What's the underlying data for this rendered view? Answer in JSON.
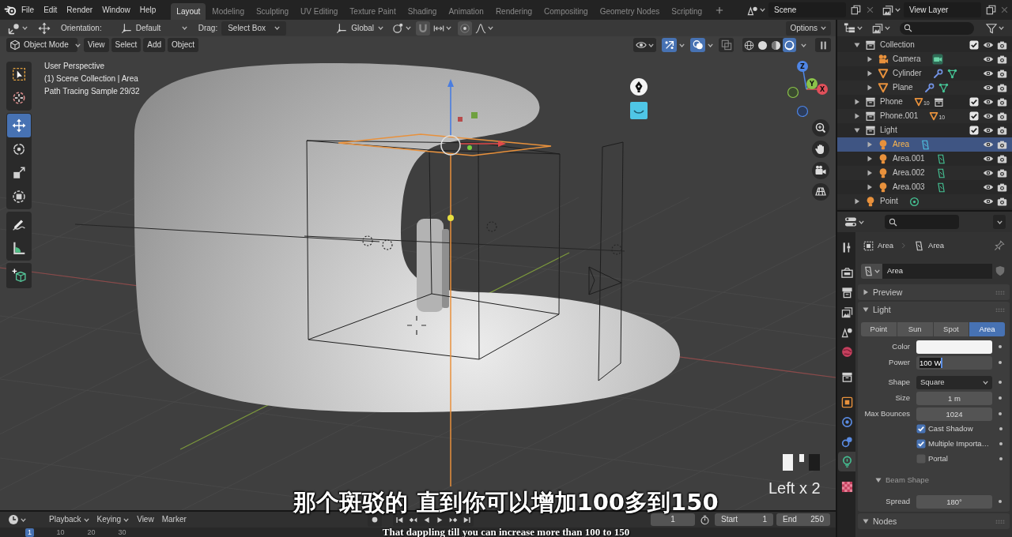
{
  "topbar": {
    "menus": [
      "File",
      "Edit",
      "Render",
      "Window",
      "Help"
    ],
    "workspaces": [
      {
        "label": "Layout",
        "selected": true
      },
      {
        "label": "Modeling",
        "selected": false
      },
      {
        "label": "Sculpting",
        "selected": false
      },
      {
        "label": "UV Editing",
        "selected": false
      },
      {
        "label": "Texture Paint",
        "selected": false
      },
      {
        "label": "Shading",
        "selected": false
      },
      {
        "label": "Animation",
        "selected": false
      },
      {
        "label": "Rendering",
        "selected": false
      },
      {
        "label": "Compositing",
        "selected": false
      },
      {
        "label": "Geometry Nodes",
        "selected": false
      },
      {
        "label": "Scripting",
        "selected": false
      }
    ],
    "scene": "Scene",
    "view_layer": "View Layer"
  },
  "viewport": {
    "tool_settings": {
      "orientation_label": "Orientation:",
      "orientation": "Default",
      "drag_label": "Drag:",
      "drag": "Select Box",
      "transform_orientation": "Global",
      "options": "Options"
    },
    "header": {
      "mode": "Object Mode",
      "menus": [
        "View",
        "Select",
        "Add",
        "Object"
      ],
      "toggles": [
        {
          "kind": "gizmos",
          "on": true
        },
        {
          "kind": "overlays",
          "on": true
        },
        {
          "kind": "xray",
          "on": false
        }
      ],
      "shading": [
        {
          "kind": "wireframe",
          "selected": false
        },
        {
          "kind": "solid",
          "selected": false
        },
        {
          "kind": "material",
          "selected": false
        },
        {
          "kind": "rendered",
          "selected": true
        }
      ]
    },
    "tools": [
      {
        "kind": "select_box",
        "selected": false
      },
      {
        "kind": "cursor",
        "selected": false
      },
      {
        "kind": "move",
        "selected": true
      },
      {
        "kind": "rotate",
        "selected": false
      },
      {
        "kind": "scale",
        "selected": false
      },
      {
        "kind": "transform",
        "selected": false
      },
      {
        "kind": "annotate",
        "selected": false
      },
      {
        "kind": "measure",
        "selected": false
      },
      {
        "kind": "add_cube",
        "selected": false
      }
    ],
    "info": [
      "User Perspective",
      "(1) Scene Collection | Area",
      "Path Tracing Sample 29/32"
    ],
    "gizmo_axes": [
      "X",
      "Y",
      "Z"
    ],
    "keystroke": "Left x 2",
    "subtitles": [
      "那个斑驳的 直到你可以增加100多到150",
      "That dappling till you can increase more than 100 to 150"
    ]
  },
  "timeline": {
    "menus": [
      {
        "label": "Playback",
        "kind": "popover"
      },
      {
        "label": "Keying",
        "kind": "popover"
      },
      {
        "label": "View",
        "kind": "menu"
      },
      {
        "label": "Marker",
        "kind": "menu"
      }
    ],
    "frame": "1",
    "start_label": "Start",
    "start": "1",
    "end_label": "End",
    "end": "250",
    "ruler": [
      {
        "label": "1",
        "selected": true
      },
      {
        "label": "10",
        "selected": false
      },
      {
        "label": "20",
        "selected": false
      },
      {
        "label": "30",
        "selected": false
      }
    ]
  },
  "outliner": {
    "items": [
      {
        "kind": "collection",
        "name": "Collection",
        "expanded": true,
        "checked": true,
        "selected": false,
        "children": [
          {
            "kind": "camera",
            "name": "Camera",
            "expanded": false,
            "selected": false,
            "data": [
              {
                "kind": "camera_data"
              }
            ]
          },
          {
            "kind": "mesh",
            "name": "Cylinder",
            "expanded": false,
            "selected": false,
            "data": [
              {
                "kind": "modifier"
              },
              {
                "kind": "mesh_data"
              }
            ]
          },
          {
            "kind": "mesh",
            "name": "Plane",
            "expanded": false,
            "selected": false,
            "data": [
              {
                "kind": "modifier"
              },
              {
                "kind": "mesh_data"
              }
            ]
          }
        ]
      },
      {
        "kind": "collection",
        "name": "Phone",
        "expanded": false,
        "checked": true,
        "selected": false,
        "data": [
          {
            "kind": "mesh_objects",
            "count": "10"
          },
          {
            "kind": "collection"
          }
        ]
      },
      {
        "kind": "collection",
        "name": "Phone.001",
        "expanded": false,
        "checked": true,
        "selected": false,
        "data": [
          {
            "kind": "mesh_objects",
            "count": "10"
          }
        ]
      },
      {
        "kind": "collection",
        "name": "Light",
        "expanded": true,
        "checked": true,
        "selected": false,
        "children": [
          {
            "kind": "light",
            "name": "Area",
            "expanded": false,
            "selected": true,
            "data": [
              {
                "kind": "area_light_data"
              }
            ]
          },
          {
            "kind": "light",
            "name": "Area.001",
            "expanded": false,
            "selected": false,
            "data": [
              {
                "kind": "area_light_data"
              }
            ]
          },
          {
            "kind": "light",
            "name": "Area.002",
            "expanded": false,
            "selected": false,
            "data": [
              {
                "kind": "area_light_data"
              }
            ]
          },
          {
            "kind": "light",
            "name": "Area.003",
            "expanded": false,
            "selected": false,
            "data": [
              {
                "kind": "area_light_data"
              }
            ]
          }
        ]
      },
      {
        "kind": "light",
        "name": "Point",
        "expanded": false,
        "selected": false,
        "data": [
          {
            "kind": "point_light_data"
          }
        ]
      }
    ]
  },
  "properties": {
    "tabs": [
      {
        "kind": "tool",
        "selected": false
      },
      {
        "kind": "render",
        "selected": false
      },
      {
        "kind": "output",
        "selected": false
      },
      {
        "kind": "view_layer",
        "selected": false
      },
      {
        "kind": "scene",
        "selected": false
      },
      {
        "kind": "world",
        "selected": false
      },
      {
        "kind": "collection",
        "selected": false
      },
      {
        "kind": "object",
        "selected": false
      },
      {
        "kind": "physics",
        "selected": false
      },
      {
        "kind": "constraints",
        "selected": false
      },
      {
        "kind": "data",
        "selected": true
      },
      {
        "kind": "texture",
        "selected": false
      }
    ],
    "breadcrumb": [
      {
        "kind": "object",
        "label": "Area"
      },
      {
        "kind": "light_data",
        "label": "Area"
      }
    ],
    "datablock": "Area",
    "panels": [
      {
        "title": "Preview",
        "expanded": false
      },
      {
        "title": "Light",
        "expanded": true,
        "light_types": [
          {
            "label": "Point",
            "selected": false
          },
          {
            "label": "Sun",
            "selected": false
          },
          {
            "label": "Spot",
            "selected": false
          },
          {
            "label": "Area",
            "selected": true
          }
        ],
        "fields": [
          {
            "kind": "color",
            "label": "Color",
            "color": "#f4f4f4"
          },
          {
            "kind": "editing",
            "label": "Power",
            "value": "100 W"
          },
          {
            "kind": "dropdown",
            "label": "Shape",
            "value": "Square"
          },
          {
            "kind": "number",
            "label": "Size",
            "value": "1 m"
          },
          {
            "kind": "number",
            "label": "Max Bounces",
            "value": "1024"
          },
          {
            "kind": "checkbox",
            "label": "Cast Shadow",
            "checked": true
          },
          {
            "kind": "checkbox",
            "label": "Multiple Importa…",
            "checked": true
          },
          {
            "kind": "checkbox",
            "label": "Portal",
            "checked": false
          }
        ],
        "subpanels": [
          {
            "title": "Beam Shape",
            "expanded": true,
            "fields": [
              {
                "kind": "number",
                "label": "Spread",
                "value": "180°"
              }
            ]
          }
        ]
      },
      {
        "title": "Nodes",
        "expanded": true
      }
    ]
  }
}
